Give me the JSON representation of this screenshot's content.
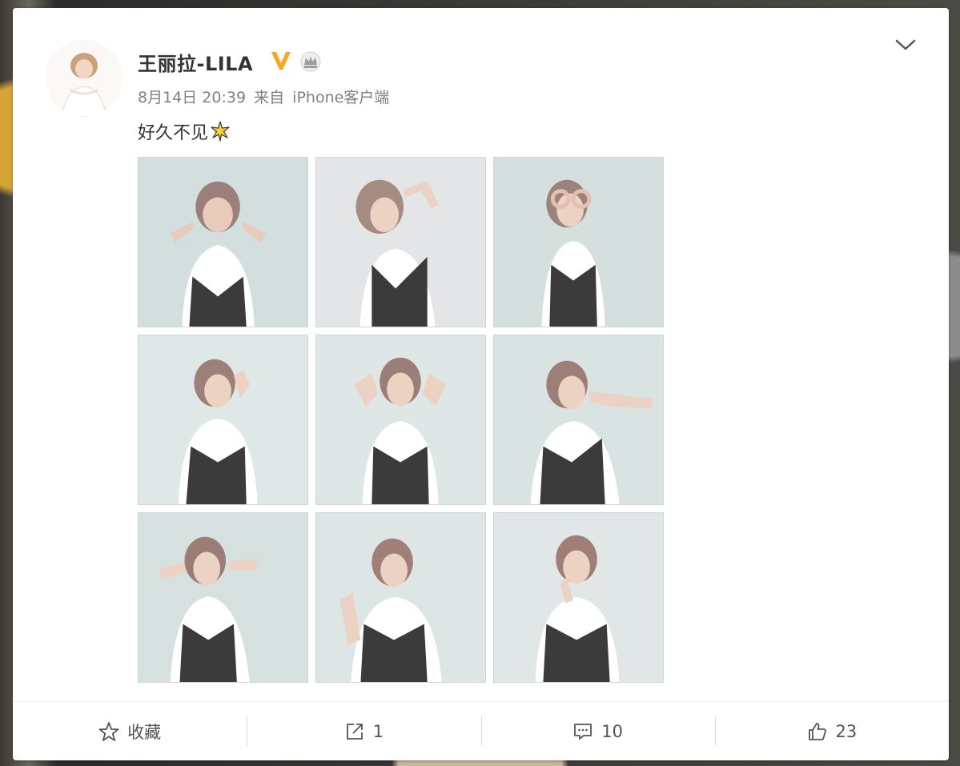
{
  "post": {
    "author": "王丽拉-LILA",
    "verified_badge": "V",
    "member_icon": "crown-icon",
    "date": "8月14日 20:39",
    "source_prefix": "来自",
    "source": "iPhone客户端",
    "text": "好久不见",
    "emoji": "sparkle-icon"
  },
  "photos": [
    {
      "label": "photo-1"
    },
    {
      "label": "photo-2"
    },
    {
      "label": "photo-3"
    },
    {
      "label": "photo-4"
    },
    {
      "label": "photo-5"
    },
    {
      "label": "photo-6"
    },
    {
      "label": "photo-7"
    },
    {
      "label": "photo-8"
    },
    {
      "label": "photo-9"
    }
  ],
  "actions": {
    "favorite_label": "收藏",
    "repost_count": "1",
    "comment_count": "10",
    "like_count": "23"
  },
  "colors": {
    "verified_orange": "#f5a623",
    "text_primary": "#333333",
    "text_secondary": "#808080"
  }
}
